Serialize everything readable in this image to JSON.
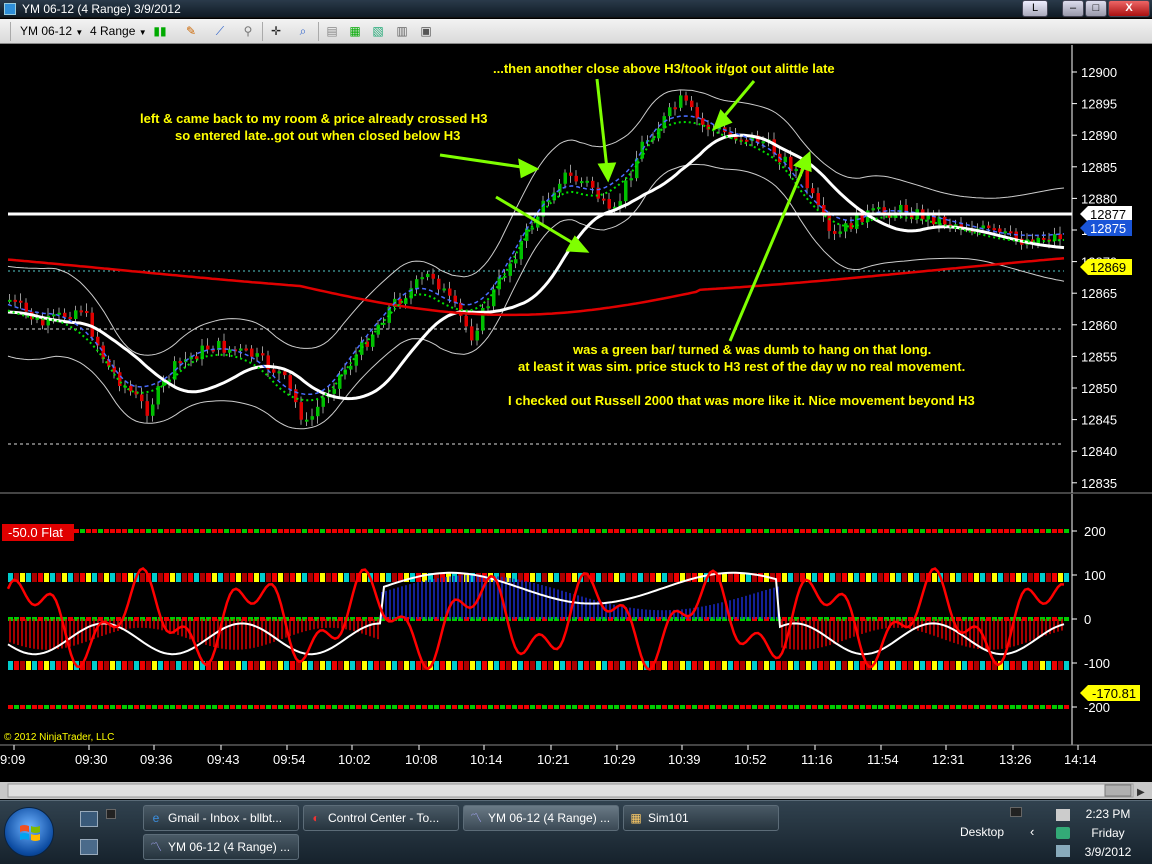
{
  "window": {
    "title": "YM 06-12 (4 Range)  3/9/2012",
    "btn_l": "L",
    "btn_min": "–",
    "btn_max": "□",
    "btn_close": "X"
  },
  "toolbar": {
    "instrument": "YM 06-12",
    "interval": "4 Range"
  },
  "price_axis": [
    "12900",
    "12895",
    "12890",
    "12885",
    "12880",
    "12875",
    "12870",
    "12865",
    "12860",
    "12855",
    "12850",
    "12845",
    "12840",
    "12835"
  ],
  "price_tags": {
    "white_line": "12877",
    "blue_tag": "12875",
    "yellow_tag": "12869"
  },
  "indicator": {
    "label": "-50.0 Flat",
    "axis": [
      "200",
      "100",
      "0",
      "-100",
      "-200"
    ],
    "value_tag": "-170.81"
  },
  "copyright": "© 2012 NinjaTrader, LLC",
  "time_axis": [
    "9:09",
    "09:30",
    "09:36",
    "09:43",
    "09:54",
    "10:02",
    "10:08",
    "10:14",
    "10:21",
    "10:29",
    "10:39",
    "10:52",
    "11:16",
    "11:54",
    "12:31",
    "13:26",
    "14:14"
  ],
  "annotations": {
    "note1_line1": "left & came back to my room & price already crossed H3",
    "note1_line2": "so entered late..got out when closed below H3",
    "note2": "...then another close above H3/took it/got out alittle late",
    "note3_line1": "was a green bar/ turned & was dumb to hang on that long.",
    "note3_line2": "at least it was sim.   price stuck to H3 rest of the day w no real movement.",
    "note4": "I checked out Russell 2000 that was more like it. Nice movement beyond H3"
  },
  "taskbar": {
    "tasks": [
      "Gmail - Inbox - bllbt...",
      "Control Center - To...",
      "YM 06-12 (4 Range) ...",
      "Sim101",
      "YM 06-12 (4 Range) ..."
    ],
    "desktop_label": "Desktop",
    "time": "2:23 PM",
    "day": "Friday",
    "date": "3/9/2012"
  },
  "colors": {
    "annotation": "#ffff00",
    "arrow": "#7fff00",
    "bull": "#00c000",
    "bear": "#e00000",
    "ma_red": "#e00000",
    "tag_blue": "#1a55d8",
    "tag_yellow": "#ffff00"
  }
}
